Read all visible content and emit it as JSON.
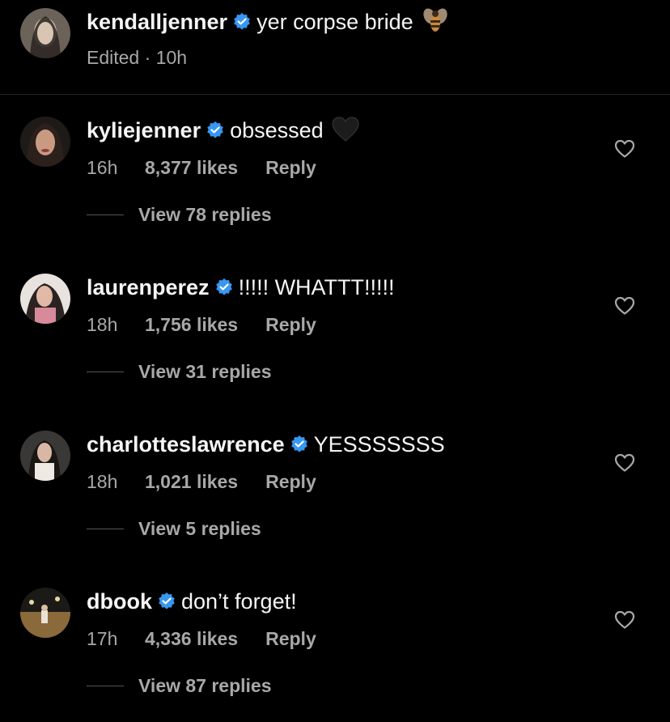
{
  "caption": {
    "username": "kendalljenner",
    "text": "yer corpse bride",
    "meta": "Edited · 10h",
    "emoji_icon": "bee-emoji"
  },
  "comments": [
    {
      "username": "kyliejenner",
      "text": "obsessed",
      "emoji_icon": "black-heart-emoji",
      "time": "16h",
      "likes": "8,377 likes",
      "reply": "Reply",
      "view_replies": "View 78 replies"
    },
    {
      "username": "laurenperez",
      "text": "!!!!! WHATTT!!!!!",
      "time": "18h",
      "likes": "1,756 likes",
      "reply": "Reply",
      "view_replies": "View 31 replies"
    },
    {
      "username": "charlotteslawrence",
      "text": "YESSSSSSS",
      "time": "18h",
      "likes": "1,021 likes",
      "reply": "Reply",
      "view_replies": "View 5 replies"
    },
    {
      "username": "dbook",
      "text": "don’t forget!",
      "time": "17h",
      "likes": "4,336 likes",
      "reply": "Reply",
      "view_replies": "View 87 replies"
    }
  ],
  "colors": {
    "background": "#000000",
    "primary_text": "#f5f5f5",
    "secondary_text": "#a8a8a8",
    "verified_badge": "#3897f0",
    "divider": "#262626"
  }
}
